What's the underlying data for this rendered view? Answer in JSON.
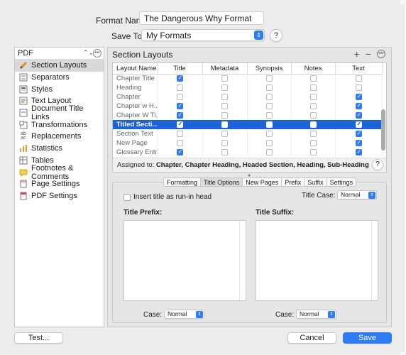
{
  "header": {
    "format_name_label": "Format Name:",
    "format_name_value": "The Dangerous Why Format",
    "save_to_label": "Save To:",
    "save_to_value": "My Formats",
    "help": "?"
  },
  "sidebar": {
    "dropdown": "PDF",
    "items": [
      {
        "label": "Section Layouts",
        "icon": "section-layouts-icon"
      },
      {
        "label": "Separators",
        "icon": "separators-icon"
      },
      {
        "label": "Styles",
        "icon": "styles-icon"
      },
      {
        "label": "Text Layout",
        "icon": "text-layout-icon"
      },
      {
        "label": "Document Title Links",
        "icon": "document-title-links-icon"
      },
      {
        "label": "Transformations",
        "icon": "transformations-icon"
      },
      {
        "label": "Replacements",
        "icon": "replacements-icon"
      },
      {
        "label": "Statistics",
        "icon": "statistics-icon"
      },
      {
        "label": "Tables",
        "icon": "tables-icon"
      },
      {
        "label": "Footnotes & Comments",
        "icon": "footnotes-icon"
      },
      {
        "label": "Page Settings",
        "icon": "page-settings-icon"
      },
      {
        "label": "PDF Settings",
        "icon": "pdf-settings-icon"
      }
    ]
  },
  "panel": {
    "title": "Section Layouts",
    "columns": [
      "Layout Name",
      "Title",
      "Metadata",
      "Synopsis",
      "Notes",
      "Text"
    ],
    "rows": [
      {
        "name": "Chapter Title",
        "checks": [
          true,
          false,
          false,
          false,
          false
        ]
      },
      {
        "name": "Heading",
        "checks": [
          false,
          false,
          false,
          false,
          false
        ]
      },
      {
        "name": "Chapter",
        "checks": [
          false,
          false,
          false,
          false,
          true
        ]
      },
      {
        "name": "Chapter w H...",
        "checks": [
          true,
          false,
          false,
          false,
          true
        ]
      },
      {
        "name": "Chapter W Ti...",
        "checks": [
          true,
          false,
          false,
          false,
          true
        ]
      },
      {
        "name": "Titled Secti...",
        "checks": [
          true,
          false,
          false,
          false,
          true
        ],
        "selected": true
      },
      {
        "name": "Section Text",
        "checks": [
          false,
          false,
          false,
          false,
          true
        ]
      },
      {
        "name": "New Page",
        "checks": [
          false,
          false,
          false,
          false,
          true
        ]
      },
      {
        "name": "Glossary Entry",
        "checks": [
          true,
          false,
          false,
          false,
          true
        ]
      }
    ],
    "assigned_label": "Assigned to:",
    "assigned_value": "Chapter, Chapter Heading, Headed Section, Heading, Sub-Heading"
  },
  "tabs": [
    "Formatting",
    "Title Options",
    "New Pages",
    "Prefix",
    "Suffix",
    "Settings"
  ],
  "title_options": {
    "runin_label": "Insert title as run-in head",
    "title_case_label": "Title Case:",
    "title_case_value": "Normal",
    "prefix_label": "Title Prefix:",
    "suffix_label": "Title Suffix:",
    "case_label": "Case:",
    "prefix_case_value": "Normal",
    "suffix_case_value": "Normal"
  },
  "buttons": {
    "test": "Test...",
    "cancel": "Cancel",
    "save": "Save"
  },
  "colors": {
    "accent": "#2f7bf5",
    "selection": "#1d63d8"
  }
}
